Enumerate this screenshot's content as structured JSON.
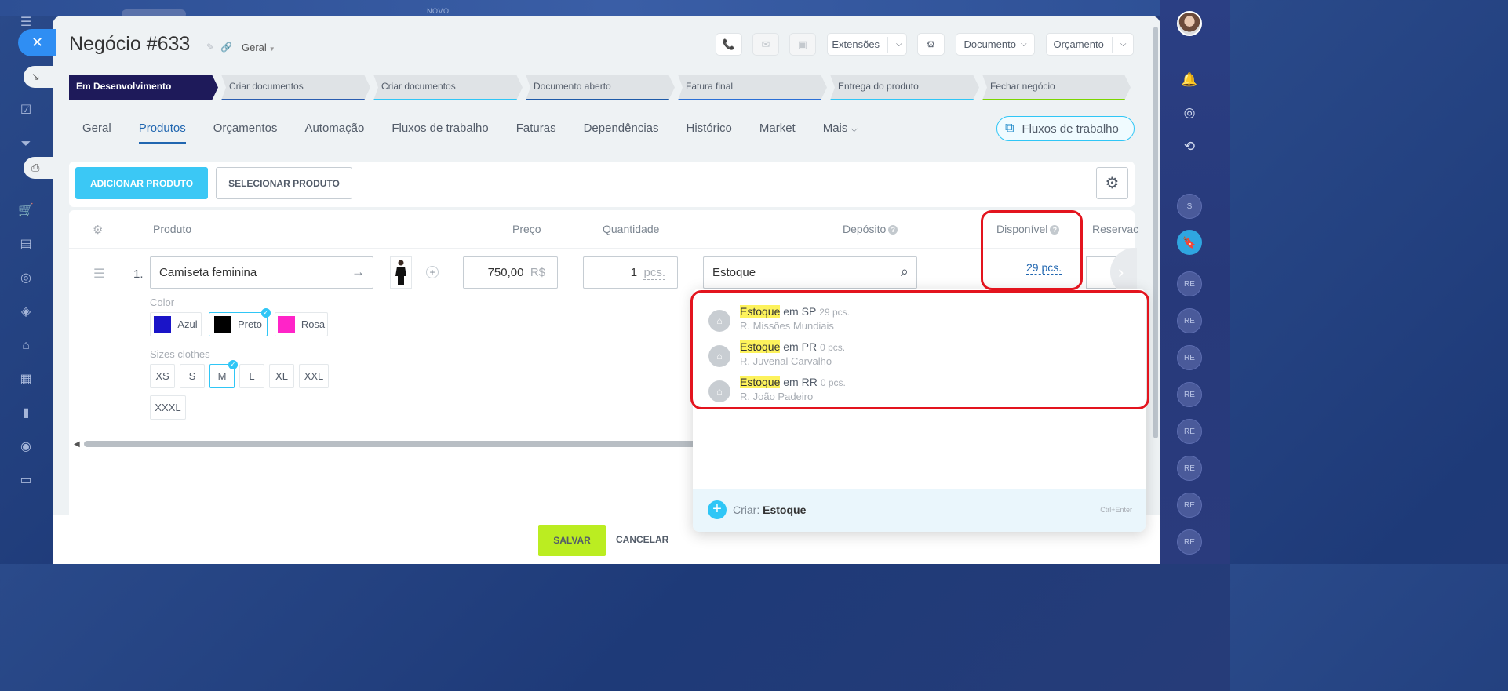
{
  "desktop": {
    "novo_label": "NOVO"
  },
  "deal": {
    "title": "Negócio #633",
    "pipeline": "Geral"
  },
  "top_buttons": {
    "extensions": "Extensões",
    "document": "Documento",
    "quote": "Orçamento"
  },
  "stages": [
    {
      "label": "Em Desenvolvimento",
      "color": "#1e1a5a"
    },
    {
      "label": "Criar documentos",
      "color": "#2a5db0"
    },
    {
      "label": "Criar documentos",
      "color": "#2fc6f6"
    },
    {
      "label": "Documento aberto",
      "color": "#1e5aa8"
    },
    {
      "label": "Fatura final",
      "color": "#2a6fd6"
    },
    {
      "label": "Entrega do produto",
      "color": "#2fc6f6"
    },
    {
      "label": "Fechar negócio",
      "color": "#7bd500"
    }
  ],
  "tabs": [
    {
      "label": "Geral"
    },
    {
      "label": "Produtos"
    },
    {
      "label": "Orçamentos"
    },
    {
      "label": "Automação"
    },
    {
      "label": "Fluxos de trabalho"
    },
    {
      "label": "Faturas"
    },
    {
      "label": "Dependências"
    },
    {
      "label": "Histórico"
    },
    {
      "label": "Market"
    },
    {
      "label": "Mais"
    }
  ],
  "workflows_button": "Fluxos de trabalho",
  "product_toolbar": {
    "add_label": "ADICIONAR PRODUTO",
    "select_label": "SELECIONAR PRODUTO"
  },
  "table": {
    "headers": {
      "product": "Produto",
      "price": "Preço",
      "quantity": "Quantidade",
      "warehouse": "Depósito",
      "available": "Disponível",
      "reserved": "Reservac"
    },
    "row": {
      "index": "1.",
      "name": "Camiseta feminina",
      "price": "750,00",
      "currency": "R$",
      "quantity": "1",
      "unit": "pcs.",
      "warehouse": "Estoque",
      "available": "29 pcs."
    },
    "color_label": "Color",
    "colors": [
      {
        "label": "Azul",
        "swatch": "#1a14c8",
        "selected": false
      },
      {
        "label": "Preto",
        "swatch": "#000000",
        "selected": true
      },
      {
        "label": "Rosa",
        "swatch": "#ff24c8",
        "selected": false
      }
    ],
    "sizes_label": "Sizes clothes",
    "sizes": [
      "XS",
      "S",
      "M",
      "L",
      "XL",
      "XXL",
      "XXXL"
    ],
    "selected_size": "M"
  },
  "warehouse_dropdown": {
    "items": [
      {
        "highlight": "Estoque",
        "rest": " em SP",
        "count": "29 pcs.",
        "address": "R. Missões Mundiais"
      },
      {
        "highlight": "Estoque",
        "rest": " em PR",
        "count": "0 pcs.",
        "address": "R. Juvenal Carvalho"
      },
      {
        "highlight": "Estoque",
        "rest": " em RR",
        "count": "0 pcs.",
        "address": "R. João Padeiro"
      }
    ],
    "create_prefix": "Criar:",
    "create_value": "Estoque",
    "shortcut": "Ctrl+Enter"
  },
  "footer": {
    "save": "SALVAR",
    "cancel": "CANCELAR"
  },
  "right_rail": {
    "s_label": "S",
    "re_label": "RE"
  }
}
